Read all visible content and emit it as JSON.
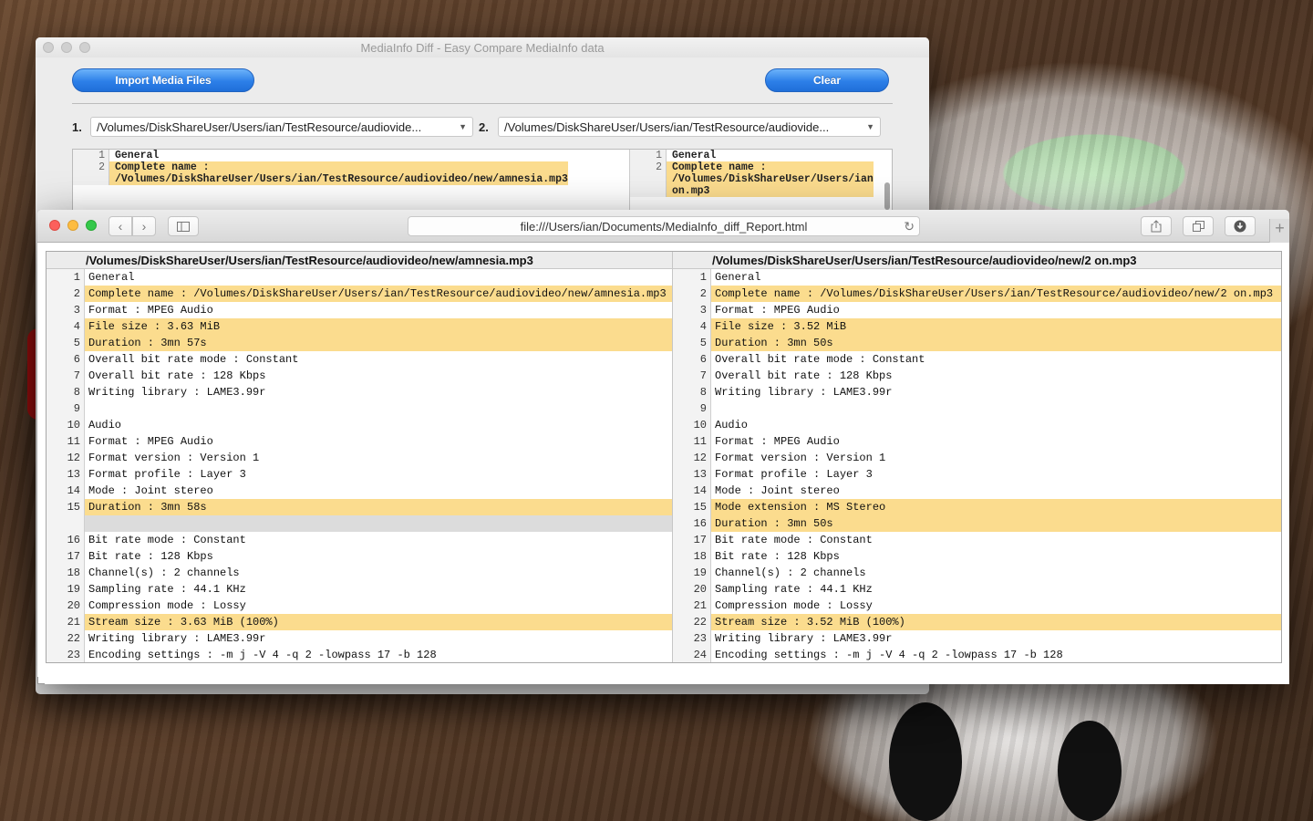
{
  "back_window": {
    "title": "MediaInfo Diff - Easy Compare MediaInfo data",
    "import_label": "Import Media Files",
    "clear_label": "Clear",
    "path1_num": "1.",
    "path1": "/Volumes/DiskShareUser/Users/ian/TestResource/audiovide...",
    "path2_num": "2.",
    "path2": "/Volumes/DiskShareUser/Users/ian/TestResource/audiovide...",
    "left_rows": [
      {
        "n": "1",
        "t": "General",
        "hl": false
      },
      {
        "n": "2",
        "t": "Complete name :\n/Volumes/DiskShareUser/Users/ian/TestResource/audiovideo/new/amnesia.mp3",
        "hl": true
      }
    ],
    "right_rows": [
      {
        "n": "1",
        "t": "General",
        "hl": false
      },
      {
        "n": "2",
        "t": "Complete name :\n/Volumes/DiskShareUser/Users/ian\non.mp3",
        "hl": true
      }
    ]
  },
  "browser": {
    "url": "file:///Users/ian/Documents/MediaInfo_diff_Report.html",
    "icons": {
      "back": "chevron-left-icon",
      "forward": "chevron-right-icon",
      "sidebar": "sidebar-icon",
      "reload": "reload-icon",
      "share": "share-icon",
      "tabs": "tabs-icon",
      "download": "download-icon",
      "new_tab": "plus-icon"
    }
  },
  "report": {
    "left_header": "/Volumes/DiskShareUser/Users/ian/TestResource/audiovideo/new/amnesia.mp3",
    "right_header": "/Volumes/DiskShareUser/Users/ian/TestResource/audiovideo/new/2 on.mp3",
    "left_rows": [
      {
        "n": "1",
        "t": "General",
        "hl": false
      },
      {
        "n": "2",
        "t": "Complete name : /Volumes/DiskShareUser/Users/ian/TestResource/audiovideo/new/amnesia.mp3",
        "hl": true
      },
      {
        "n": "3",
        "t": "Format : MPEG Audio",
        "hl": false
      },
      {
        "n": "4",
        "t": "File size : 3.63 MiB",
        "hl": true
      },
      {
        "n": "5",
        "t": "Duration : 3mn 57s",
        "hl": true
      },
      {
        "n": "6",
        "t": "Overall bit rate mode : Constant",
        "hl": false
      },
      {
        "n": "7",
        "t": "Overall bit rate : 128 Kbps",
        "hl": false
      },
      {
        "n": "8",
        "t": "Writing library : LAME3.99r",
        "hl": false
      },
      {
        "n": "9",
        "t": "",
        "hl": false
      },
      {
        "n": "10",
        "t": "Audio",
        "hl": false
      },
      {
        "n": "11",
        "t": "Format : MPEG Audio",
        "hl": false
      },
      {
        "n": "12",
        "t": "Format version : Version 1",
        "hl": false
      },
      {
        "n": "13",
        "t": "Format profile : Layer 3",
        "hl": false
      },
      {
        "n": "14",
        "t": "Mode : Joint stereo",
        "hl": false
      },
      {
        "n": "15",
        "t": "Duration : 3mn 58s",
        "hl": true
      },
      {
        "n": "",
        "t": "",
        "hl": false,
        "blank": true
      },
      {
        "n": "16",
        "t": "Bit rate mode : Constant",
        "hl": false
      },
      {
        "n": "17",
        "t": "Bit rate : 128 Kbps",
        "hl": false
      },
      {
        "n": "18",
        "t": "Channel(s) : 2 channels",
        "hl": false
      },
      {
        "n": "19",
        "t": "Sampling rate : 44.1 KHz",
        "hl": false
      },
      {
        "n": "20",
        "t": "Compression mode : Lossy",
        "hl": false
      },
      {
        "n": "21",
        "t": "Stream size : 3.63 MiB (100%)",
        "hl": true
      },
      {
        "n": "22",
        "t": "Writing library : LAME3.99r",
        "hl": false
      },
      {
        "n": "23",
        "t": "Encoding settings : -m j -V 4 -q 2 -lowpass 17 -b 128",
        "hl": false
      }
    ],
    "right_rows": [
      {
        "n": "1",
        "t": "General",
        "hl": false
      },
      {
        "n": "2",
        "t": "Complete name : /Volumes/DiskShareUser/Users/ian/TestResource/audiovideo/new/2 on.mp3",
        "hl": true
      },
      {
        "n": "3",
        "t": "Format : MPEG Audio",
        "hl": false
      },
      {
        "n": "4",
        "t": "File size : 3.52 MiB",
        "hl": true
      },
      {
        "n": "5",
        "t": "Duration : 3mn 50s",
        "hl": true
      },
      {
        "n": "6",
        "t": "Overall bit rate mode : Constant",
        "hl": false
      },
      {
        "n": "7",
        "t": "Overall bit rate : 128 Kbps",
        "hl": false
      },
      {
        "n": "8",
        "t": "Writing library : LAME3.99r",
        "hl": false
      },
      {
        "n": "9",
        "t": "",
        "hl": false
      },
      {
        "n": "10",
        "t": "Audio",
        "hl": false
      },
      {
        "n": "11",
        "t": "Format : MPEG Audio",
        "hl": false
      },
      {
        "n": "12",
        "t": "Format version : Version 1",
        "hl": false
      },
      {
        "n": "13",
        "t": "Format profile : Layer 3",
        "hl": false
      },
      {
        "n": "14",
        "t": "Mode : Joint stereo",
        "hl": false
      },
      {
        "n": "15",
        "t": "Mode extension : MS Stereo",
        "hl": true
      },
      {
        "n": "16",
        "t": "Duration : 3mn 50s",
        "hl": true
      },
      {
        "n": "17",
        "t": "Bit rate mode : Constant",
        "hl": false
      },
      {
        "n": "18",
        "t": "Bit rate : 128 Kbps",
        "hl": false
      },
      {
        "n": "19",
        "t": "Channel(s) : 2 channels",
        "hl": false
      },
      {
        "n": "20",
        "t": "Sampling rate : 44.1 KHz",
        "hl": false
      },
      {
        "n": "21",
        "t": "Compression mode : Lossy",
        "hl": false
      },
      {
        "n": "22",
        "t": "Stream size : 3.52 MiB (100%)",
        "hl": true
      },
      {
        "n": "23",
        "t": "Writing library : LAME3.99r",
        "hl": false
      },
      {
        "n": "24",
        "t": "Encoding settings : -m j -V 4 -q 2 -lowpass 17 -b 128",
        "hl": false
      }
    ]
  },
  "colors": {
    "diff_highlight": "#fbdc8e",
    "missing_row": "#dcdcdc",
    "button_blue": "#2d7fe8"
  }
}
